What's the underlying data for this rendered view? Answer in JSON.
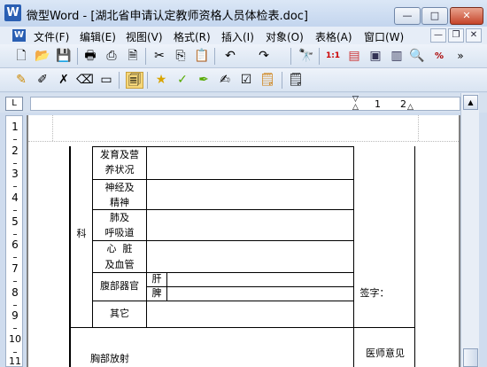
{
  "window": {
    "title": "微型Word - [湖北省申请认定教师资格人员体检表.doc]",
    "app_icon_letter": "W",
    "minimize": "—",
    "maximize": "□",
    "close": "✕"
  },
  "menu": {
    "icon_letter": "W",
    "items": [
      "文件(F)",
      "编辑(E)",
      "视图(V)",
      "格式(R)",
      "插入(I)",
      "对象(O)",
      "表格(A)",
      "窗口(W)"
    ],
    "mdi_min": "—",
    "mdi_restore": "❐",
    "mdi_close": "✕"
  },
  "toolbar1": {
    "icons": [
      "new-document-icon",
      "open-folder-icon",
      "save-icon",
      "print-icon",
      "pdf-export-icon",
      "print-preview-icon",
      "format-painter-icon",
      "cut-icon",
      "copy-icon",
      "paste-icon",
      "undo-icon",
      "redo-icon",
      "find-icon",
      "page-number-icon",
      "insert-table-icon",
      "insert-textbox-icon",
      "columns-icon",
      "zoom-icon",
      "percent-icon"
    ],
    "glyphs": [
      "🗋",
      "📂",
      "💾",
      "🖶",
      "⎙",
      "🗎",
      "🖌",
      "✂",
      "⎘",
      "📋",
      "↶",
      "↷",
      "🔭",
      "1:1",
      "▤",
      "▣",
      "▥",
      "🔍",
      "%"
    ],
    "overflow": "»"
  },
  "toolbar2": {
    "icons": [
      "edit-note-icon",
      "pencil-icon",
      "erase-icon",
      "clear-icon",
      "blank-page-icon",
      "track-changes-icon",
      "star-pen-icon",
      "green-pen-icon",
      "marker-icon",
      "highlighter-icon",
      "accept-icon",
      "review-icon"
    ],
    "glyphs": [
      "✎",
      "✐",
      "✗",
      "⌫",
      "▭",
      "🗐",
      "★",
      "✓",
      "✒",
      "✍",
      "☑",
      "🗒"
    ]
  },
  "ruler": {
    "corner": "L",
    "numbers": [
      "1",
      "2"
    ]
  },
  "vruler": {
    "numbers": [
      "1",
      "2",
      "3",
      "4",
      "5",
      "6",
      "7",
      "8",
      "9",
      "10",
      "11"
    ]
  },
  "table": {
    "section_label": "科",
    "rows": [
      {
        "line1": "发育及营",
        "line2": "养状况"
      },
      {
        "line1": "神经及",
        "line2": "精神"
      },
      {
        "line1": "肺及",
        "line2": "呼吸道"
      },
      {
        "line1": "心  脏",
        "line2": "及血管"
      },
      {
        "line1": "腹部器官",
        "line2": ""
      },
      {
        "line1": "其它",
        "line2": ""
      }
    ],
    "organ_liver": "肝",
    "organ_spleen": "脾",
    "signature": "签字：",
    "chest_xray": "胸部放射",
    "doctor_opinion": "医师意见"
  }
}
